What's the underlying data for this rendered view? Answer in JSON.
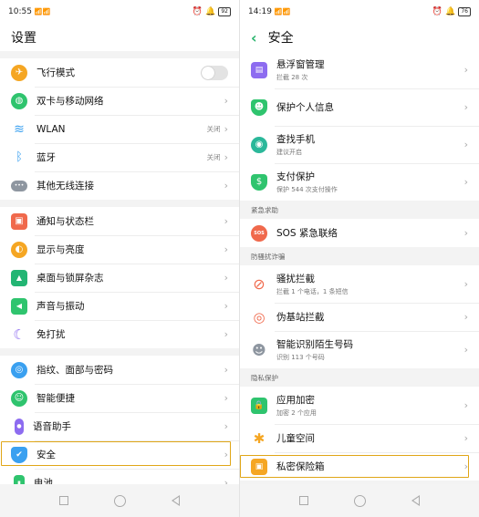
{
  "left": {
    "status": {
      "time": "10:55",
      "signal": "📶📶",
      "right_icons": [
        "⏰",
        "🔔"
      ],
      "battery": "92"
    },
    "title": "设置",
    "group1": [
      {
        "label": "飞行模式",
        "icon": "airplane-icon",
        "color": "#f5a623",
        "glyph": "✈",
        "control": "toggle"
      },
      {
        "label": "双卡与移动网络",
        "icon": "globe-icon",
        "color": "#2fc46e",
        "glyph": "◍",
        "control": "chevron"
      },
      {
        "label": "WLAN",
        "value": "关闭",
        "icon": "wifi-icon",
        "color": "#3aa0f0",
        "glyph": "≋",
        "control": "chevron"
      },
      {
        "label": "蓝牙",
        "value": "关闭",
        "icon": "bluetooth-icon",
        "color": "#3aa0f0",
        "glyph": "ᛒ",
        "control": "chevron"
      },
      {
        "label": "其他无线连接",
        "icon": "more-connections-icon",
        "color": "#8e96a0",
        "glyph": "•••",
        "control": "chevron"
      }
    ],
    "group2": [
      {
        "label": "通知与状态栏",
        "icon": "notification-icon",
        "color": "#f0694c",
        "glyph": "▣"
      },
      {
        "label": "显示与亮度",
        "icon": "brightness-icon",
        "color": "#f5a623",
        "glyph": "◐"
      },
      {
        "label": "桌面与锁屏杂志",
        "icon": "wallpaper-icon",
        "color": "#22b573",
        "glyph": "▲"
      },
      {
        "label": "声音与振动",
        "icon": "sound-icon",
        "color": "#2fc46e",
        "glyph": "◀"
      },
      {
        "label": "免打扰",
        "icon": "moon-icon",
        "color": "#8d6cf0",
        "glyph": "☾"
      }
    ],
    "group3": [
      {
        "label": "指纹、面部与密码",
        "icon": "fingerprint-icon",
        "color": "#3aa0f0",
        "glyph": "◎"
      },
      {
        "label": "智能便捷",
        "icon": "smart-assist-icon",
        "color": "#2fc46e",
        "glyph": "☺"
      },
      {
        "label": "语音助手",
        "icon": "microphone-icon",
        "color": "#8d6cf0",
        "glyph": "●"
      },
      {
        "label": "安全",
        "icon": "shield-icon",
        "color": "#3aa0f0",
        "glyph": "✔"
      },
      {
        "label": "电池",
        "icon": "battery-icon",
        "color": "#2fc46e",
        "glyph": "▮"
      }
    ]
  },
  "right": {
    "status": {
      "time": "14:19",
      "signal": "📶📶",
      "right_icons": [
        "⏰",
        "🔔"
      ],
      "battery": "76"
    },
    "title": "安全",
    "group1": [
      {
        "label": "悬浮窗管理",
        "sub": "拦截 28 次",
        "icon": "floating-window-icon",
        "color": "#8d6cf0",
        "glyph": "▤"
      },
      {
        "label": "保护个人信息",
        "icon": "privacy-shield-icon",
        "color": "#2fc46e",
        "glyph": "☻"
      },
      {
        "label": "查找手机",
        "sub": "建议开启",
        "icon": "find-phone-icon",
        "color": "#2bb89a",
        "glyph": "◉"
      },
      {
        "label": "支付保护",
        "sub": "保护 544 次支付操作",
        "icon": "payment-shield-icon",
        "color": "#2fc46e",
        "glyph": "$"
      }
    ],
    "section_sos": "紧急求助",
    "sos": [
      {
        "label": "SOS 紧急联络",
        "icon": "sos-icon",
        "color": "#f0694c",
        "glyph": "SOS"
      }
    ],
    "section_fraud": "防骚扰诈骗",
    "fraud": [
      {
        "label": "骚扰拦截",
        "sub": "拦截 1 个电话，1 条短信",
        "icon": "block-icon",
        "color": "#f0694c",
        "glyph": "⊘"
      },
      {
        "label": "伪基站拦截",
        "icon": "antenna-icon",
        "color": "#f0694c",
        "glyph": "◎"
      },
      {
        "label": "智能识别陌生号码",
        "sub": "识别 113 个号码",
        "icon": "caller-id-icon",
        "color": "#8e96a0",
        "glyph": "☻"
      }
    ],
    "section_privacy": "隐私保护",
    "privacy": [
      {
        "label": "应用加密",
        "sub": "加密 2 个应用",
        "icon": "app-lock-icon",
        "color": "#2fc46e",
        "glyph": "🔒"
      },
      {
        "label": "儿童空间",
        "icon": "kids-space-icon",
        "color": "#f5a623",
        "glyph": "✱"
      },
      {
        "label": "私密保险箱",
        "icon": "private-safe-icon",
        "color": "#f5a623",
        "glyph": "▣"
      }
    ]
  }
}
